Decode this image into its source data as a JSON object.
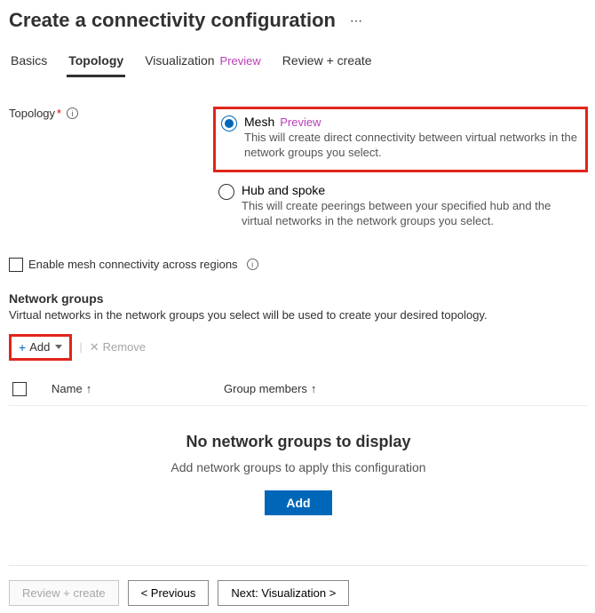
{
  "header": {
    "title": "Create a connectivity configuration"
  },
  "tabs": {
    "basics": "Basics",
    "topology": "Topology",
    "visualization": "Visualization",
    "visualization_badge": "Preview",
    "review": "Review + create"
  },
  "topology": {
    "label": "Topology",
    "mesh": {
      "title": "Mesh",
      "badge": "Preview",
      "desc": "This will create direct connectivity between virtual networks in the network groups you select."
    },
    "hub": {
      "title": "Hub and spoke",
      "desc": "This will create peerings between your specified hub and the virtual networks in the network groups you select."
    },
    "mesh_checkbox": "Enable mesh connectivity across regions"
  },
  "network_groups": {
    "title": "Network groups",
    "desc": "Virtual networks in the network groups you select will be used to create your desired topology.",
    "add": "Add",
    "remove": "Remove",
    "col_name": "Name",
    "col_members": "Group members",
    "empty_title": "No network groups to display",
    "empty_desc": "Add network groups to apply this configuration",
    "empty_button": "Add"
  },
  "footer": {
    "review": "Review + create",
    "previous": "< Previous",
    "next": "Next: Visualization >"
  }
}
